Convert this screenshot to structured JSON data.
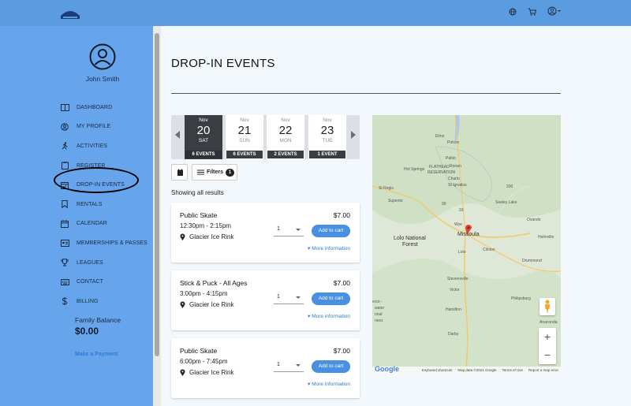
{
  "user": {
    "name": "John Smith"
  },
  "sidebar": {
    "items": [
      {
        "label": "Dashboard",
        "icon": "columns-icon"
      },
      {
        "label": "My Profile",
        "icon": "user-circle-icon"
      },
      {
        "label": "Activities",
        "icon": "running-icon"
      },
      {
        "label": "Register",
        "icon": "clipboard-icon"
      },
      {
        "label": "Drop-in Events",
        "icon": "calendar-check-icon"
      },
      {
        "label": "Rentals",
        "icon": "bookmark-icon"
      },
      {
        "label": "Calendar",
        "icon": "calendar-icon"
      },
      {
        "label": "Memberships & Passes",
        "icon": "id-card-icon"
      },
      {
        "label": "Leagues",
        "icon": "trophy-icon"
      },
      {
        "label": "Contact",
        "icon": "keyboard-icon"
      },
      {
        "label": "Billing",
        "icon": "dollar-icon"
      }
    ],
    "balance_label": "Family Balance",
    "balance_value": "$0.00",
    "pay_link": "Make a Payment"
  },
  "page": {
    "title": "DROP-IN EVENTS",
    "showing": "Showing all results"
  },
  "dates": [
    {
      "month": "Nov",
      "day": "20",
      "dow": "SAT",
      "count": "6 EVENTS",
      "active": true
    },
    {
      "month": "Nov",
      "day": "21",
      "dow": "SUN",
      "count": "6 EVENTS",
      "active": false
    },
    {
      "month": "Nov",
      "day": "22",
      "dow": "MON",
      "count": "2 EVENTS",
      "active": false
    },
    {
      "month": "Nov",
      "day": "23",
      "dow": "TUE",
      "count": "1 EVENT",
      "active": false
    }
  ],
  "filters": {
    "label": "Filters",
    "count": "1"
  },
  "events": [
    {
      "title": "Public Skate",
      "time": "12:30pm - 2:15pm",
      "location": "Glacier Ice Rink",
      "price": "$7.00",
      "qty": "1",
      "cart_label": "Add to cart",
      "more_label": "More information"
    },
    {
      "title": "Stick & Puck - All Ages",
      "time": "3:00pm - 4:15pm",
      "location": "Glacier Ice Rink",
      "price": "$7.00",
      "qty": "1",
      "cart_label": "Add to cart",
      "more_label": "More information"
    },
    {
      "title": "Public Skate",
      "time": "6:00pm - 7:45pm",
      "location": "Glacier Ice Rink",
      "price": "$7.00",
      "qty": "1",
      "cart_label": "Add to cart",
      "more_label": "More information"
    }
  ],
  "map": {
    "labels": {
      "flathead": "FLATHEAD",
      "reservation": "RESERVATION",
      "polson": "Polson",
      "elmo": "Elmo",
      "pablo": "Pablo",
      "ronan": "Ronan",
      "charlo": "Charlo",
      "st_ignatius": "St Ignatius",
      "hot_springs": "Hot Springs",
      "st_regis": "St Regis",
      "superior": "Superior",
      "seeley_lake": "Seeley Lake",
      "ovando": "Ovando",
      "helmville": "Helmville",
      "missoula": "Missoula",
      "lolo_nf_1": "Lolo National",
      "lolo_nf_2": "Forest",
      "lolo": "Lolo",
      "clinton": "Clinton",
      "drummond": "Drummond",
      "stevensville": "Stevensville",
      "victor": "Victor",
      "hamilton": "Hamilton",
      "darby": "Darby",
      "philipsburg": "Philipsburg",
      "anaconda": "Anaconda",
      "bitterroot_1": "erce -",
      "bitterroot_2": "water",
      "bitterroot_3": "onal",
      "bitterroot_4": "ness",
      "wye": "Wye",
      "hwy_90": "90",
      "hwy_93": "93",
      "hwy_200": "200"
    },
    "zoom_in": "+",
    "zoom_out": "−",
    "footer": [
      "Keyboard shortcuts",
      "Map data ©2021 Google",
      "Terms of Use",
      "Report a map error"
    ],
    "logo_text": "Google"
  },
  "colors": {
    "header": "#5b9be0",
    "sidebar": "#66a5ec",
    "accent": "#4a90e2",
    "link": "#2f7ad6",
    "active_date": "#3a3d42"
  }
}
